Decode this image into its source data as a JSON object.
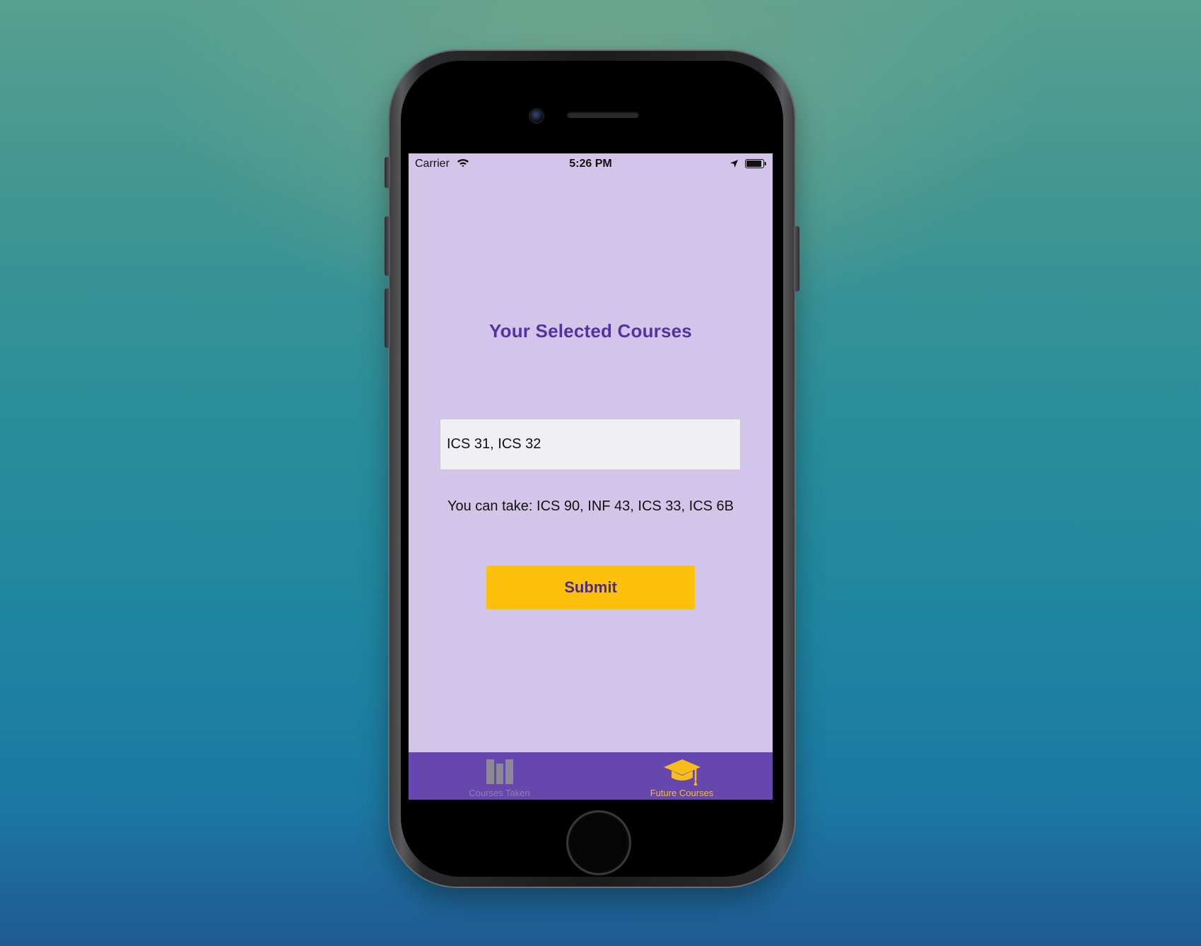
{
  "status_bar": {
    "carrier": "Carrier",
    "time": "5:26 PM",
    "icons": [
      "wifi-icon",
      "location-arrow-icon",
      "battery-icon"
    ]
  },
  "main": {
    "heading": "Your Selected Courses",
    "input_value": "ICS 31, ICS 32",
    "result": "You can take: ICS 90, INF 43, ICS 33, ICS 6B",
    "submit_label": "Submit"
  },
  "tabs": [
    {
      "label": "Courses Taken",
      "icon": "books-icon",
      "selected": false
    },
    {
      "label": "Future Courses",
      "icon": "graduation-cap-icon",
      "selected": true
    }
  ],
  "colors": {
    "screen_background": "#d2c5e9",
    "heading": "#5532a3",
    "button": "#fdc10c",
    "button_text": "#4a2a92",
    "tab_bar": "#6547ae",
    "tab_selected": "#f9bd1b",
    "tab_unselected": "#8c80ad"
  }
}
